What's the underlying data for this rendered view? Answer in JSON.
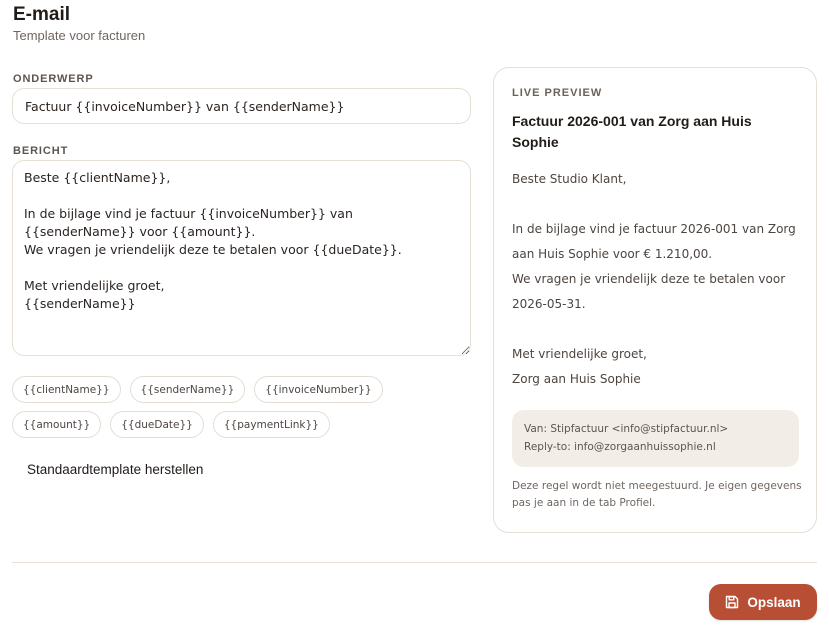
{
  "header": {
    "title": "E-mail",
    "subtitle": "Template voor facturen"
  },
  "subject": {
    "label": "ONDERWERP",
    "value": "Factuur {{invoiceNumber}} van {{senderName}}"
  },
  "message": {
    "label": "BERICHT",
    "value": "Beste {{clientName}},\n\nIn de bijlage vind je factuur {{invoiceNumber}} van {{senderName}} voor {{amount}}.\nWe vragen je vriendelijk deze te betalen voor {{dueDate}}.\n\nMet vriendelijke groet,\n{{senderName}}"
  },
  "placeholders": [
    "{{clientName}}",
    "{{senderName}}",
    "{{invoiceNumber}}",
    "{{amount}}",
    "{{dueDate}}",
    "{{paymentLink}}"
  ],
  "reset_label": "Standaardtemplate herstellen",
  "preview": {
    "label": "LIVE PREVIEW",
    "subject": "Factuur 2026-001 van Zorg aan Huis Sophie",
    "body": "Beste Studio Klant,\n\nIn de bijlage vind je factuur 2026-001 van Zorg aan Huis Sophie voor € 1.210,00.\nWe vragen je vriendelijk deze te betalen voor 2026-05-31.\n\nMet vriendelijke groet,\nZorg aan Huis Sophie",
    "from": "Van: Stipfactuur <info@stipfactuur.nl>",
    "reply_to": "Reply-to: info@zorgaanhuissophie.nl",
    "note": "Deze regel wordt niet meegestuurd. Je eigen gegevens pas je aan in de tab Profiel."
  },
  "footer": {
    "save_label": "Opslaan",
    "save_icon": "save-icon"
  },
  "colors": {
    "accent": "#b84e34",
    "sender_box_bg": "#f2ede6",
    "border": "#e6dfd6"
  }
}
